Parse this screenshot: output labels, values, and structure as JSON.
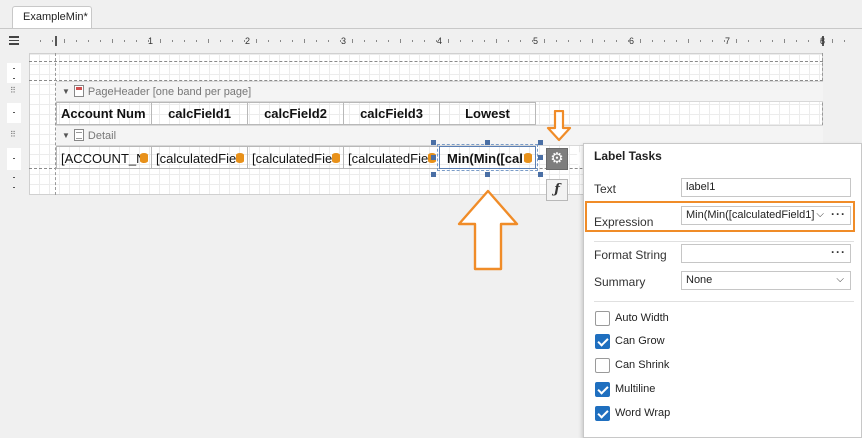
{
  "tab": {
    "title": "ExampleMin*"
  },
  "ruler": {
    "numbers": [
      "1",
      "2",
      "3",
      "4",
      "5",
      "6",
      "7",
      "8"
    ]
  },
  "bands": {
    "page_header": "PageHeader [one band per page]",
    "detail": "Detail"
  },
  "header_cells": [
    "Account Num",
    "calcField1",
    "calcField2",
    "calcField3",
    "Lowest"
  ],
  "detail_cells": [
    "[ACCOUNT_N",
    "[calculatedFie",
    "[calculatedFie",
    "[calculatedFie",
    "Min(Min([cal"
  ],
  "smart_tag_icon": "gear-icon",
  "expression_button": {
    "label": "ƒ"
  },
  "label_tasks": {
    "title": "Label Tasks",
    "text_label": "Text",
    "text_value": "label1",
    "expression_label": "Expression",
    "expression_value": "Min(Min([calculatedField1]",
    "format_string_label": "Format String",
    "format_string_value": "",
    "summary_label": "Summary",
    "summary_value": "None",
    "ellipsis": "···",
    "options": [
      {
        "label": "Auto Width",
        "checked": false
      },
      {
        "label": "Can Grow",
        "checked": true
      },
      {
        "label": "Can Shrink",
        "checked": false
      },
      {
        "label": "Multiline",
        "checked": true
      },
      {
        "label": "Word Wrap",
        "checked": true
      }
    ]
  },
  "colors": {
    "accent": "#f08c28",
    "checkbox": "#1f6fbf",
    "selection": "#4a6fa5"
  }
}
